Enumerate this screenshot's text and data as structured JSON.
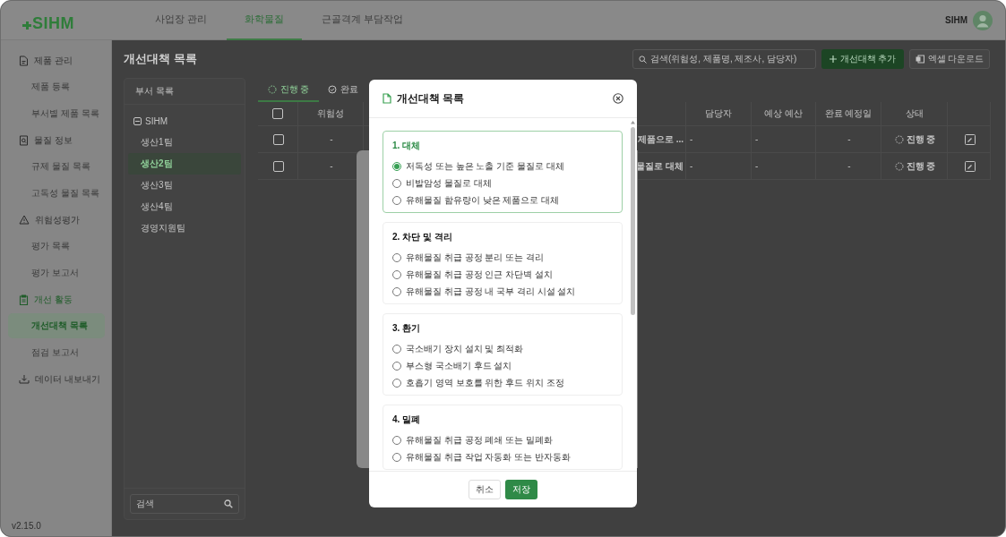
{
  "header": {
    "logo": "SIHM",
    "nav": [
      {
        "label": "사업장 관리",
        "selected": false
      },
      {
        "label": "화학물질",
        "selected": true
      },
      {
        "label": "근골격계 부담작업",
        "selected": false
      }
    ],
    "user": "SIHM"
  },
  "sidebar": {
    "groups": [
      {
        "label": "제품 관리",
        "active": false,
        "children": [
          {
            "label": "제품 등록",
            "selected": false
          },
          {
            "label": "부서별 제품 목록",
            "selected": false
          }
        ]
      },
      {
        "label": "물질 정보",
        "active": false,
        "children": [
          {
            "label": "규제 물질 목록",
            "selected": false
          },
          {
            "label": "고독성 물질 목록",
            "selected": false
          }
        ]
      },
      {
        "label": "위험성평가",
        "active": false,
        "children": [
          {
            "label": "평가 목록",
            "selected": false
          },
          {
            "label": "평가 보고서",
            "selected": false
          }
        ]
      },
      {
        "label": "개선 활동",
        "active": true,
        "children": [
          {
            "label": "개선대책 목록",
            "selected": true
          },
          {
            "label": "점검 보고서",
            "selected": false
          }
        ]
      },
      {
        "label": "데이터 내보내기",
        "active": false
      }
    ],
    "version": "v2.15.0"
  },
  "page": {
    "title": "개선대책 목록",
    "search": {
      "placeholder": "검색(위험성, 제품명, 제조사, 담당자)"
    },
    "add_button": "개선대책 추가",
    "excel_button": "엑셀 다운로드"
  },
  "departments": {
    "title": "부서 목록",
    "tree": [
      {
        "label": "SIHM",
        "expanded": true,
        "selected": false,
        "children": [
          {
            "label": "생산1팀",
            "selected": false
          },
          {
            "label": "생산2팀",
            "selected": true
          },
          {
            "label": "생산3팀",
            "selected": false
          },
          {
            "label": "생산4팀",
            "selected": false
          },
          {
            "label": "경영지원팀",
            "selected": false
          }
        ]
      }
    ],
    "search": {
      "placeholder": "검색"
    }
  },
  "tabs": [
    {
      "label": "진행 중",
      "selected": true
    },
    {
      "label": "완료",
      "selected": false
    }
  ],
  "table": {
    "header_checked": false,
    "columns": [
      "위험성",
      "",
      "담당자",
      "예상 예산",
      "완료 예정일",
      "상태"
    ],
    "rows": [
      {
        "checked": false,
        "cells": [
          "-",
          "제품으로 ...",
          "-",
          "-",
          "-",
          "진행 중"
        ]
      },
      {
        "checked": false,
        "cells": [
          "-",
          "물질로 대체",
          "-",
          "-",
          "-",
          "진행 중"
        ]
      }
    ]
  },
  "modal": {
    "title": "개선대책 목록",
    "sections": [
      {
        "title": "1. 대체",
        "selected": true,
        "options": [
          {
            "label": "저독성 또는 높은 노출 기준 물질로 대체",
            "selected": true
          },
          {
            "label": "비발암성 물질로 대체",
            "selected": false
          },
          {
            "label": "유해물질 함유량이 낮은 제품으로 대체",
            "selected": false
          }
        ]
      },
      {
        "title": "2. 차단 및 격리",
        "selected": false,
        "options": [
          {
            "label": "유해물질 취급 공정 분리 또는 격리",
            "selected": false
          },
          {
            "label": "유해물질 취급 공정 인근 차단벽 설치",
            "selected": false
          },
          {
            "label": "유해물질 취급 공정 내 국부 격리 시설 설치",
            "selected": false
          }
        ]
      },
      {
        "title": "3. 환기",
        "selected": false,
        "options": [
          {
            "label": "국소배기 장치 설치 및 최적화",
            "selected": false
          },
          {
            "label": "부스형 국소배기 후드 설치",
            "selected": false
          },
          {
            "label": "호흡기 영역 보호를 위한 후드 위치 조정",
            "selected": false
          }
        ]
      },
      {
        "title": "4. 밀폐",
        "selected": false,
        "options": [
          {
            "label": "유해물질 취급 공정 폐쇄 또는 밀폐화",
            "selected": false
          },
          {
            "label": "유해물질 취급 작업 자동화 또는 반자동화",
            "selected": false
          }
        ]
      }
    ],
    "cancel": "취소",
    "save": "저장"
  }
}
